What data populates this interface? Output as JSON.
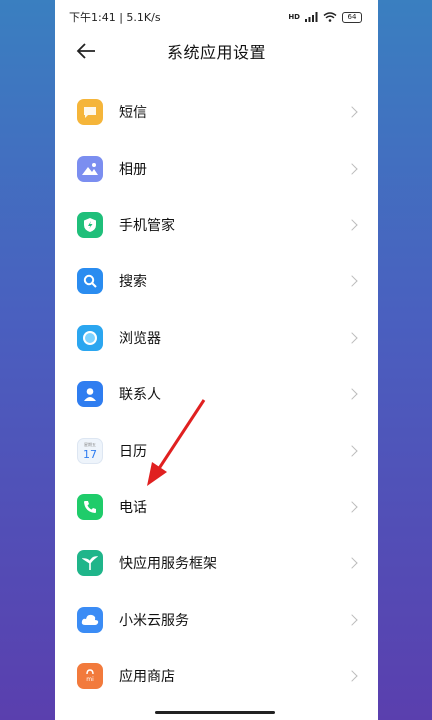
{
  "status": {
    "time_speed": "下午1:41 | 5.1K/s",
    "network": "HD",
    "battery": "64"
  },
  "header": {
    "title": "系统应用设置"
  },
  "items": [
    {
      "label": "短信",
      "icon": "message-icon",
      "color": "#f5b53a"
    },
    {
      "label": "相册",
      "icon": "gallery-icon",
      "color": "#7b8ef0"
    },
    {
      "label": "手机管家",
      "icon": "security-icon",
      "color": "#1fbf7a"
    },
    {
      "label": "搜索",
      "icon": "search-icon",
      "color": "#2a8cf0"
    },
    {
      "label": "浏览器",
      "icon": "browser-icon",
      "color": "#2ba6f0"
    },
    {
      "label": "联系人",
      "icon": "contacts-icon",
      "color": "#2f7df0"
    },
    {
      "label": "日历",
      "icon": "calendar-icon",
      "color": "#eef4fb",
      "day": "17"
    },
    {
      "label": "电话",
      "icon": "phone-icon",
      "color": "#1fcc6a"
    },
    {
      "label": "快应用服务框架",
      "icon": "quickapp-icon",
      "color": "#1fb58a"
    },
    {
      "label": "小米云服务",
      "icon": "cloud-icon",
      "color": "#3b8cf5"
    },
    {
      "label": "应用商店",
      "icon": "appstore-icon",
      "color": "#f27a3c"
    }
  ]
}
